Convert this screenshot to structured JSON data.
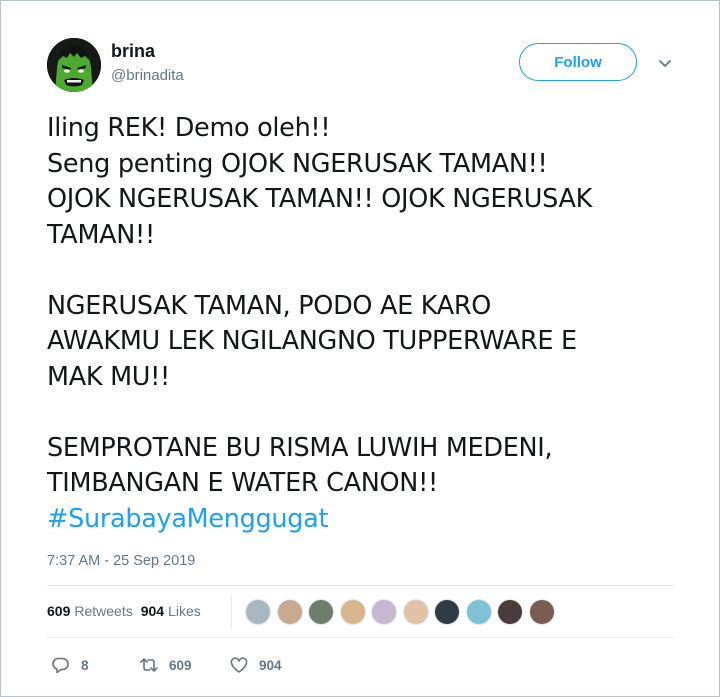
{
  "author": {
    "name": "brina",
    "handle": "@brinadita"
  },
  "follow_label": "Follow",
  "tweet": {
    "lines_1": [
      "Iling REK! Demo oleh!!",
      "Seng penting OJOK NGERUSAK TAMAN!!",
      "OJOK NGERUSAK TAMAN!! OJOK NGERUSAK",
      "TAMAN!!"
    ],
    "lines_2": [
      "NGERUSAK TAMAN, PODO AE KARO",
      "AWAKMU LEK NGILANGNO TUPPERWARE E",
      "MAK MU!!"
    ],
    "lines_3": [
      "SEMPROTANE BU RISMA LUWIH MEDENI,",
      "TIMBANGAN E WATER CANON!!"
    ],
    "hashtag": "#SurabayaMenggugat"
  },
  "timestamp": "7:37 AM - 25 Sep 2019",
  "stats": {
    "retweets_count": "609",
    "retweets_label": "Retweets",
    "likes_count": "904",
    "likes_label": "Likes"
  },
  "liker_avatars": [
    {
      "name": "liker-avatar-1",
      "color": "#aab8c2"
    },
    {
      "name": "liker-avatar-2",
      "color": "#c9a98f"
    },
    {
      "name": "liker-avatar-3",
      "color": "#6b7f6a"
    },
    {
      "name": "liker-avatar-4",
      "color": "#d8b78e"
    },
    {
      "name": "liker-avatar-5",
      "color": "#c7b8d0"
    },
    {
      "name": "liker-avatar-6",
      "color": "#e0c3a6"
    },
    {
      "name": "liker-avatar-7",
      "color": "#2f3b45"
    },
    {
      "name": "liker-avatar-8",
      "color": "#7fc2d6"
    },
    {
      "name": "liker-avatar-9",
      "color": "#4a3c3a"
    },
    {
      "name": "liker-avatar-10",
      "color": "#7a5d52"
    }
  ],
  "actions": {
    "reply_count": "8",
    "retweet_count": "609",
    "like_count": "904"
  },
  "colors": {
    "accent": "#1da1f2",
    "secondary_text": "#657786",
    "primary_text": "#14171a",
    "border": "#e6ecf0"
  },
  "icons": [
    "hulk-avatar",
    "chevron-down-icon",
    "reply-icon",
    "retweet-icon",
    "heart-icon"
  ]
}
